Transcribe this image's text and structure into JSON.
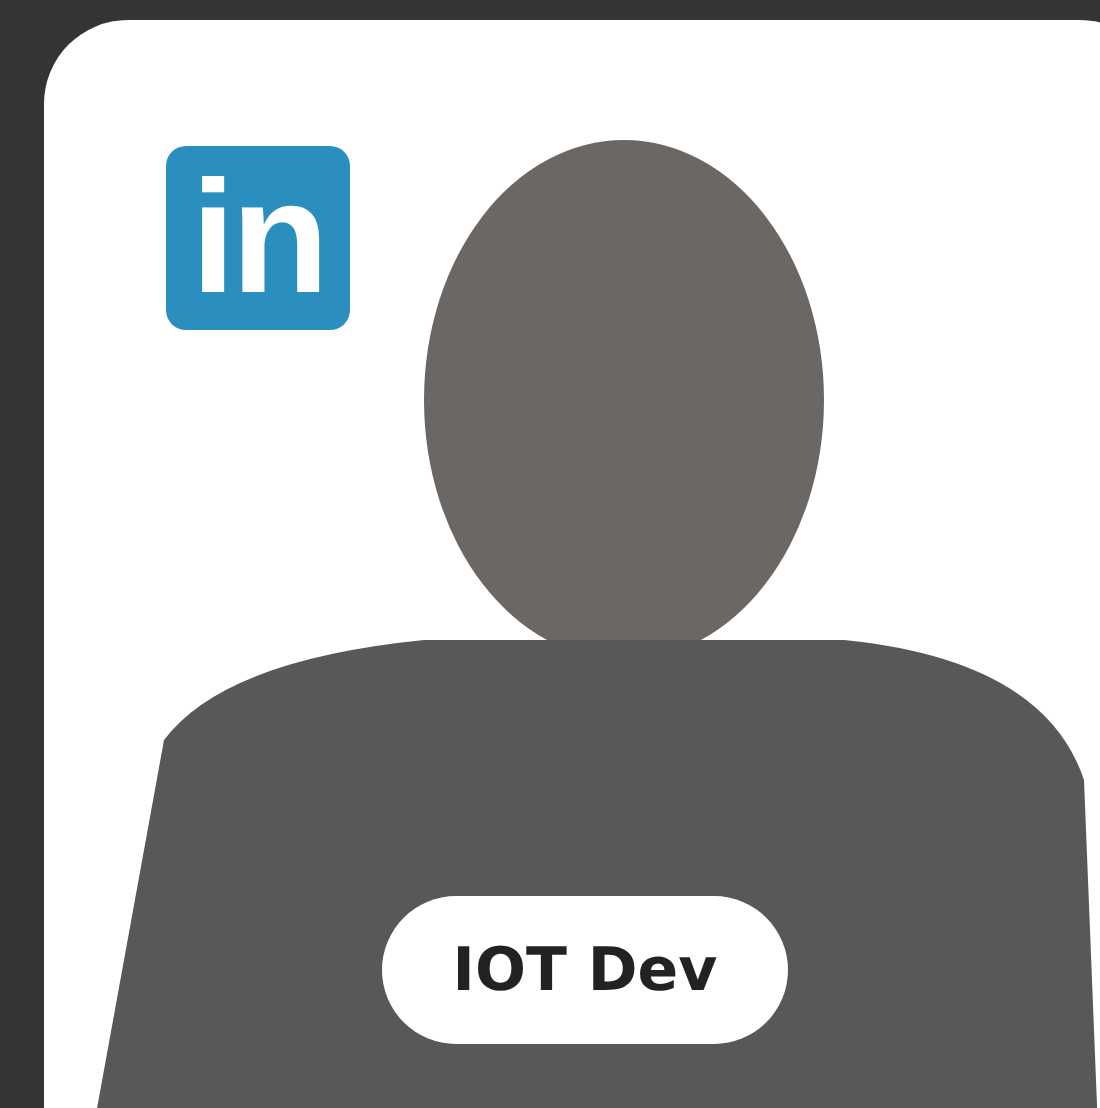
{
  "profile_card": {
    "logo_text": "in",
    "role_label": "IOT Dev"
  }
}
